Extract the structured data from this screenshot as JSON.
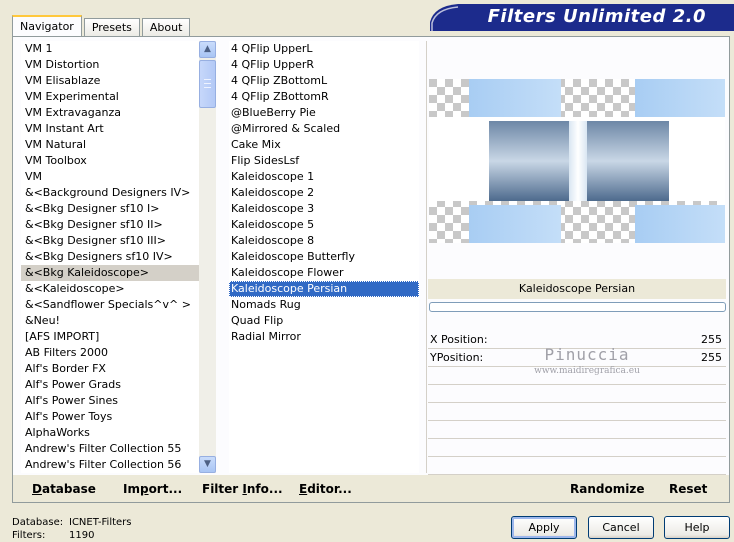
{
  "banner": {
    "title": "Filters Unlimited 2.0"
  },
  "tabs": [
    {
      "label": "Navigator",
      "active": true
    },
    {
      "label": "Presets",
      "active": false
    },
    {
      "label": "About",
      "active": false
    }
  ],
  "categories": [
    "VM 1",
    "VM Distortion",
    "VM Elisablaze",
    "VM Experimental",
    "VM Extravaganza",
    "VM Instant Art",
    "VM Natural",
    "VM Toolbox",
    "VM",
    "&<Background Designers IV>",
    "&<Bkg Designer sf10 I>",
    "&<Bkg Designer sf10 II>",
    "&<Bkg Designer sf10 III>",
    "&<Bkg Designers sf10 IV>",
    "&<Bkg Kaleidoscope>",
    "&<Kaleidoscope>",
    "&<Sandflower Specials^v^ >",
    "&Neu!",
    "[AFS IMPORT]",
    "AB Filters 2000",
    "Alf's Border FX",
    "Alf's Power Grads",
    "Alf's Power Sines",
    "Alf's Power Toys",
    "AlphaWorks",
    "Andrew's Filter Collection 55",
    "Andrew's Filter Collection 56"
  ],
  "selected_category": "&<Bkg Kaleidoscope>",
  "filters": [
    "4 QFlip UpperL",
    "4 QFlip UpperR",
    "4 QFlip ZBottomL",
    "4 QFlip ZBottomR",
    "@BlueBerry Pie",
    "@Mirrored & Scaled",
    "Cake Mix",
    "Flip SidesLsf",
    "Kaleidoscope 1",
    "Kaleidoscope 2",
    "Kaleidoscope 3",
    "Kaleidoscope 5",
    "Kaleidoscope 8",
    "Kaleidoscope Butterfly",
    "Kaleidoscope Flower",
    "Kaleidoscope Persian",
    "Nomads Rug",
    "Quad Flip",
    "Radial Mirror"
  ],
  "selected_filter": "Kaleidoscope Persian",
  "preview": {
    "filter_name": "Kaleidoscope Persian",
    "params": [
      {
        "label": "X Position:",
        "value": "255"
      },
      {
        "label": "YPosition:",
        "value": "255"
      }
    ],
    "watermark_name": "Pinuccia",
    "watermark_url": "www.maidiregrafica.eu"
  },
  "bottom": {
    "database_first": "D",
    "database_rest": "atabase",
    "import_pre": "Im",
    "import_ul": "p",
    "import_post": "ort...",
    "filterinfo_pre": "Filter ",
    "filterinfo_ul": "I",
    "filterinfo_post": "nfo...",
    "editor_first": "E",
    "editor_rest": "ditor...",
    "randomize": "Randomize",
    "reset": "Reset"
  },
  "status": {
    "database_label": "Database:",
    "database_value": "ICNET-Filters",
    "filters_label": "Filters:",
    "filters_value": "1190"
  },
  "buttons": {
    "apply": "Apply",
    "cancel": "Cancel",
    "help": "Help"
  },
  "colors": {
    "banner_bg": "#1c2b8c",
    "selection": "#316ac5",
    "accent_tab": "#ffc83c"
  }
}
